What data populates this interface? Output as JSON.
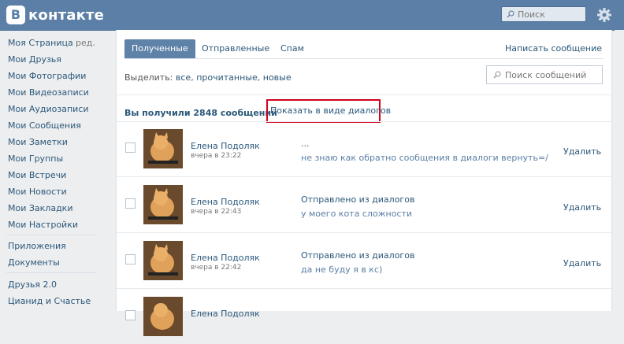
{
  "header": {
    "logo_letter": "В",
    "logo_text": "контакте",
    "search_placeholder": "Поиск"
  },
  "sidebar": {
    "items": [
      "Моя Страница",
      "Мои Друзья",
      "Мои Фотографии",
      "Мои Видеозаписи",
      "Мои Аудиозаписи",
      "Мои Сообщения",
      "Мои Заметки",
      "Мои Группы",
      "Мои Встречи",
      "Мои Новости",
      "Мои Закладки",
      "Мои Настройки"
    ],
    "edit_label": "ред.",
    "group2": [
      "Приложения",
      "Документы"
    ],
    "group3": [
      "Друзья 2.0",
      "Цианид и Счастье"
    ]
  },
  "tabs": [
    "Полученные",
    "Отправленные",
    "Спам"
  ],
  "write_message": "Написать сообщение",
  "filter": {
    "label": "Выделить:",
    "options": [
      "все",
      "прочитанные",
      "новые"
    ]
  },
  "msg_search_placeholder": "Поиск сообщений",
  "received_count": "Вы получили 2848 сообщений",
  "show_as_dialogs": "Показать в виде диалогов",
  "messages": [
    {
      "name": "Елена Подоляк",
      "time": "вчера в 23:22",
      "title": "...",
      "text": "не знаю как обратно сообщения в диалоги вернуть=/",
      "delete": "Удалить"
    },
    {
      "name": "Елена Подоляк",
      "time": "вчера в 22:43",
      "title": "Отправлено из диалогов",
      "text": "у моего кота сложности",
      "delete": "Удалить"
    },
    {
      "name": "Елена Подоляк",
      "time": "вчера в 22:42",
      "title": "Отправлено из диалогов",
      "text": "да не буду я в кс)",
      "delete": "Удалить"
    },
    {
      "name": "Елена Подоляк",
      "time": "",
      "title": "",
      "text": "",
      "delete": ""
    }
  ],
  "colors": {
    "header": "#5b7fa6",
    "link": "#2b587a",
    "highlight": "#d0021b"
  }
}
